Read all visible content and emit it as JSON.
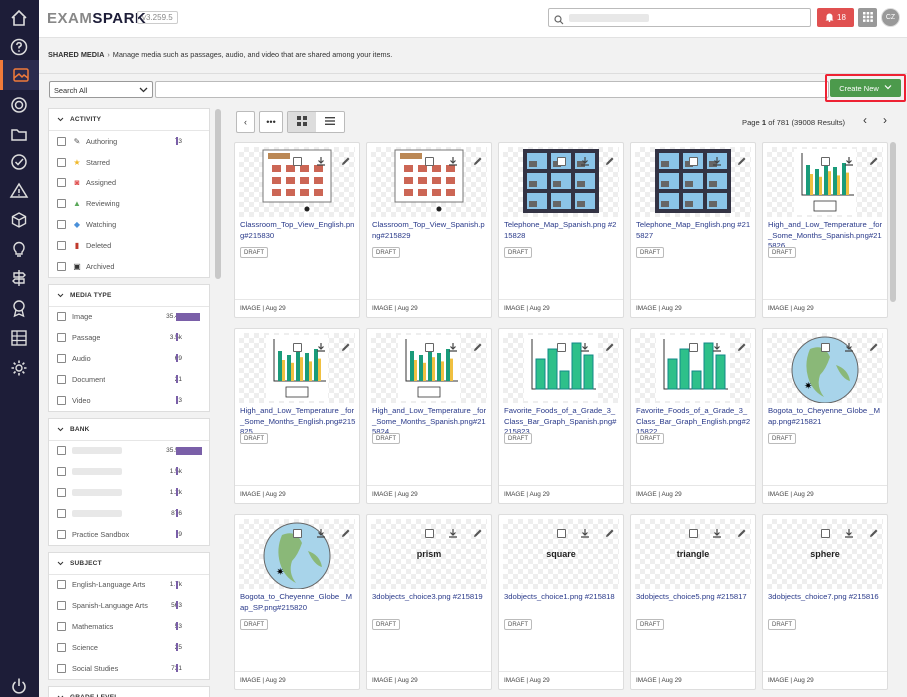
{
  "app": {
    "logo_left": "EXAM",
    "logo_right": "SPARK",
    "version": "v3.259.5",
    "notifications_count": "18",
    "avatar_initials": "CZ",
    "accent_color": "#f07a3a"
  },
  "nav": {
    "items": [
      "home-icon",
      "help-icon",
      "shared-media-icon",
      "target-icon",
      "folder-icon",
      "check-circle-icon",
      "alert-icon",
      "cube-icon",
      "lightbulb-icon",
      "signpost-icon",
      "ribbon-icon",
      "report-icon",
      "settings-icon",
      "logout-icon"
    ],
    "active": "shared-media-icon"
  },
  "breadcrumb": {
    "section": "SHARED MEDIA",
    "description": "Manage media such as passages, audio, and video that are shared among your items."
  },
  "filter": {
    "scope": "Search All",
    "search_value": "",
    "create_label": "Create New"
  },
  "facets": [
    {
      "title": "ACTIVITY",
      "items": [
        {
          "label": "Authoring",
          "count": "73",
          "icon": "pencil-icon"
        },
        {
          "label": "Starred",
          "count": "",
          "icon": "star-icon"
        },
        {
          "label": "Assigned",
          "count": "",
          "icon": "assigned-icon"
        },
        {
          "label": "Reviewing",
          "count": "",
          "icon": "thumbs-up-icon"
        },
        {
          "label": "Watching",
          "count": "",
          "icon": "watching-icon"
        },
        {
          "label": "Deleted",
          "count": "",
          "icon": "trash-icon"
        },
        {
          "label": "Archived",
          "count": "",
          "icon": "archive-icon"
        }
      ]
    },
    {
      "title": "MEDIA TYPE",
      "items": [
        {
          "label": "Image",
          "count": "35.4k",
          "level": 0.91
        },
        {
          "label": "Passage",
          "count": "3.5k",
          "level": 0.09
        },
        {
          "label": "Audio",
          "count": "69",
          "level": 0
        },
        {
          "label": "Document",
          "count": "21",
          "level": 0
        },
        {
          "label": "Video",
          "count": "3",
          "level": 0
        }
      ]
    },
    {
      "title": "BANK",
      "items": [
        {
          "label": "",
          "count": "35.5k",
          "level": 1
        },
        {
          "label": "",
          "count": "1.5k",
          "level": 0
        },
        {
          "label": "",
          "count": "1.2k",
          "level": 0
        },
        {
          "label": "",
          "count": "876",
          "level": 0
        },
        {
          "label": "Practice Sandbox",
          "count": "9",
          "level": 0
        }
      ]
    },
    {
      "title": "SUBJECT",
      "items": [
        {
          "label": "English-Language Arts",
          "count": "1.7k",
          "level": 0
        },
        {
          "label": "Spanish-Language Arts",
          "count": "563",
          "level": 0
        },
        {
          "label": "Mathematics",
          "count": "53",
          "level": 0
        },
        {
          "label": "Science",
          "count": "25",
          "level": 0
        },
        {
          "label": "Social Studies",
          "count": "731",
          "level": 0
        }
      ]
    },
    {
      "title": "GRADE LEVEL",
      "items": []
    }
  ],
  "pager": {
    "page_label": "Page",
    "page": "1",
    "of": "of 781",
    "results": "(39008 Results)"
  },
  "cards": [
    {
      "name": "Classroom_Top_View_English.png#215830",
      "status": "DRAFT",
      "meta": "IMAGE | Aug 29",
      "kind": "classroom"
    },
    {
      "name": "Classroom_Top_View_Spanish.png#215829",
      "status": "DRAFT",
      "meta": "IMAGE | Aug 29",
      "kind": "classroom"
    },
    {
      "name": "Telephone_Map_Spanish.png #215828",
      "status": "DRAFT",
      "meta": "IMAGE | Aug 29",
      "kind": "map"
    },
    {
      "name": "Telephone_Map_English.png #215827",
      "status": "DRAFT",
      "meta": "IMAGE | Aug 29",
      "kind": "map"
    },
    {
      "name": "High_and_Low_Temperature _for_Some_Months_Spanish.png#215826",
      "status": "DRAFT",
      "meta": "IMAGE | Aug 29",
      "kind": "bars"
    },
    {
      "name": "High_and_Low_Temperature _for_Some_Months_English.png#215825",
      "status": "DRAFT",
      "meta": "IMAGE | Aug 29",
      "kind": "bars"
    },
    {
      "name": "High_and_Low_Temperature _for_Some_Months_Spanish.png#215824",
      "status": "DRAFT",
      "meta": "IMAGE | Aug 29",
      "kind": "bars"
    },
    {
      "name": "Favorite_Foods_of_a_Grade_3_Class_Bar_Graph_Spanish.png#215823",
      "status": "DRAFT",
      "meta": "IMAGE | Aug 29",
      "kind": "greenbars"
    },
    {
      "name": "Favorite_Foods_of_a_Grade_3_Class_Bar_Graph_English.png#215822",
      "status": "DRAFT",
      "meta": "IMAGE | Aug 29",
      "kind": "greenbars"
    },
    {
      "name": "Bogota_to_Cheyenne_Globe _Map.png#215821",
      "status": "DRAFT",
      "meta": "IMAGE | Aug 29",
      "kind": "globe"
    },
    {
      "name": "Bogota_to_Cheyenne_Globe _Map_SP.png#215820",
      "status": "DRAFT",
      "meta": "IMAGE | Aug 29",
      "kind": "globe"
    },
    {
      "name": "3dobjects_choice3.png #215819",
      "status": "DRAFT",
      "meta": "IMAGE | Aug 29",
      "kind": "word",
      "word": "prism"
    },
    {
      "name": "3dobjects_choice1.png #215818",
      "status": "DRAFT",
      "meta": "IMAGE | Aug 29",
      "kind": "word",
      "word": "square"
    },
    {
      "name": "3dobjects_choice5.png #215817",
      "status": "DRAFT",
      "meta": "IMAGE | Aug 29",
      "kind": "word",
      "word": "triangle"
    },
    {
      "name": "3dobjects_choice7.png #215816",
      "status": "DRAFT",
      "meta": "IMAGE | Aug 29",
      "kind": "word",
      "word": "sphere"
    }
  ]
}
